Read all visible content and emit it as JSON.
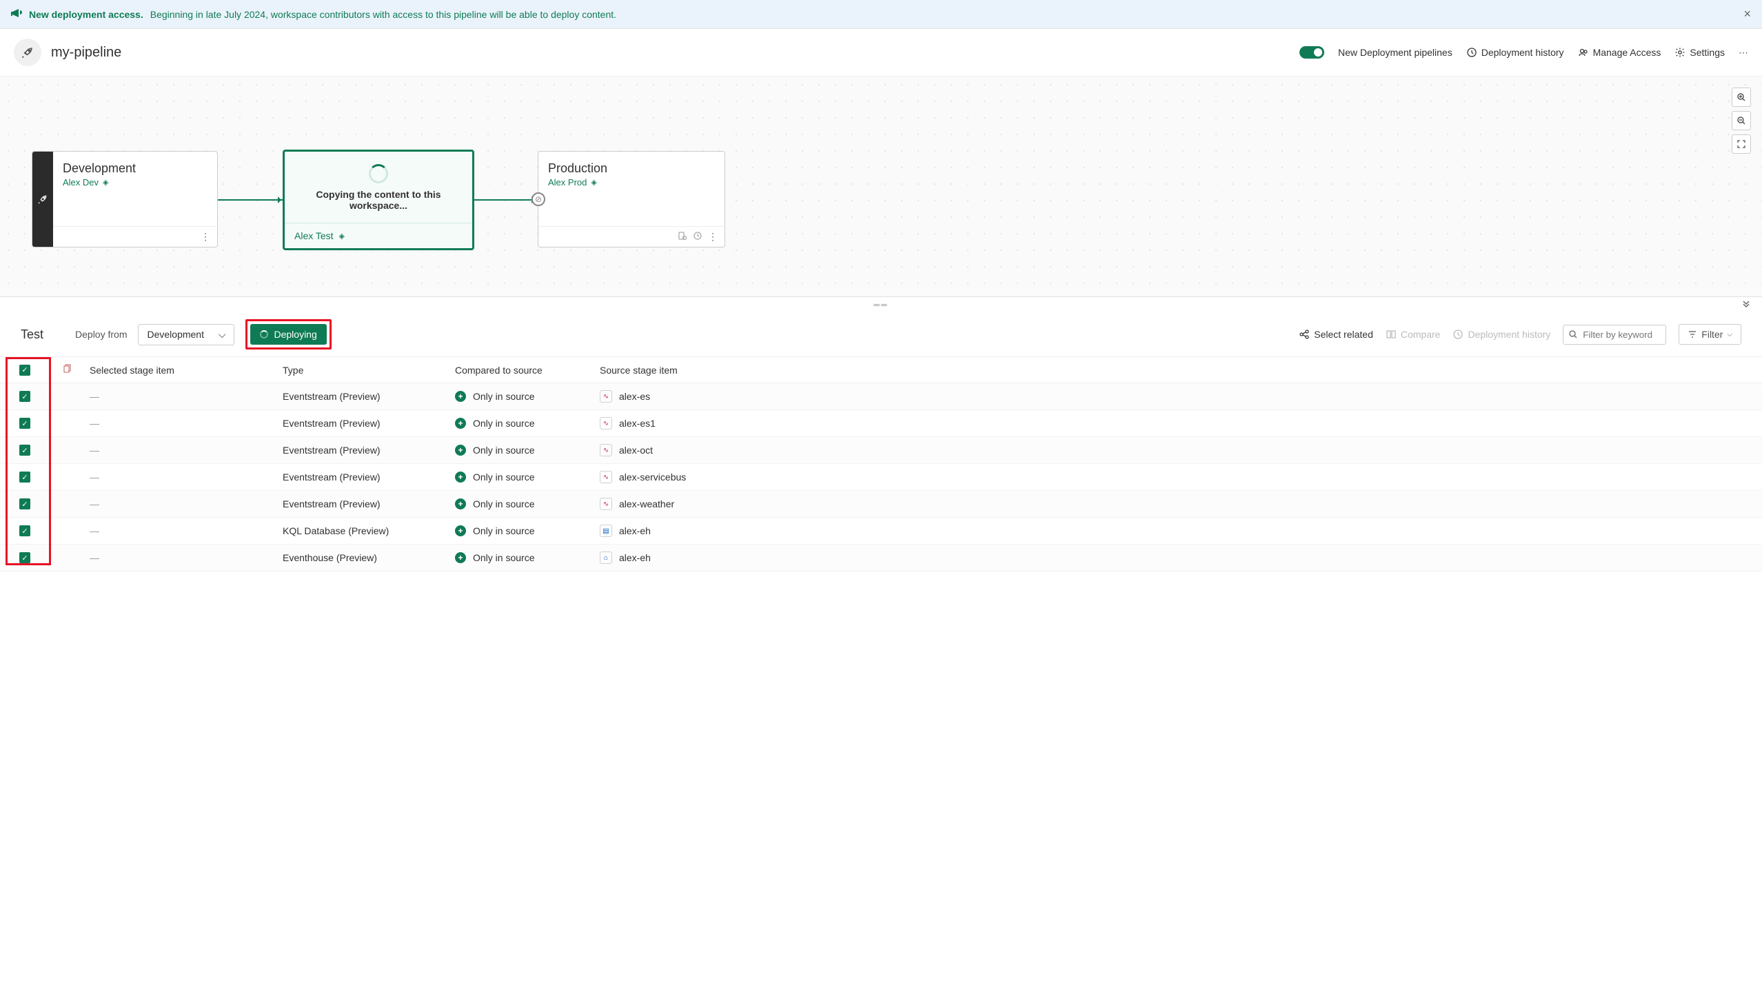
{
  "banner": {
    "title": "New deployment access.",
    "text": "Beginning in late July 2024, workspace contributors with access to this pipeline will be able to deploy content."
  },
  "header": {
    "title": "my-pipeline",
    "toggle_label": "New Deployment pipelines",
    "history": "Deployment history",
    "access": "Manage Access",
    "settings": "Settings"
  },
  "stages": {
    "dev": {
      "title": "Development",
      "sub": "Alex Dev"
    },
    "test": {
      "copying": "Copying the content to this workspace...",
      "sub": "Alex Test"
    },
    "prod": {
      "title": "Production",
      "sub": "Alex Prod"
    }
  },
  "toolbar": {
    "title": "Test",
    "deploy_from_label": "Deploy from",
    "deploy_from_value": "Development",
    "deploying": "Deploying",
    "select_related": "Select related",
    "compare": "Compare",
    "history": "Deployment history",
    "search_placeholder": "Filter by keyword",
    "filter": "Filter"
  },
  "table": {
    "headers": {
      "selected": "Selected stage item",
      "type": "Type",
      "compared": "Compared to source",
      "source": "Source stage item"
    },
    "rows": [
      {
        "sel": "—",
        "type": "Eventstream (Preview)",
        "comp": "Only in source",
        "src": "alex-es",
        "icon": "es"
      },
      {
        "sel": "—",
        "type": "Eventstream (Preview)",
        "comp": "Only in source",
        "src": "alex-es1",
        "icon": "es"
      },
      {
        "sel": "—",
        "type": "Eventstream (Preview)",
        "comp": "Only in source",
        "src": "alex-oct",
        "icon": "es"
      },
      {
        "sel": "—",
        "type": "Eventstream (Preview)",
        "comp": "Only in source",
        "src": "alex-servicebus",
        "icon": "es"
      },
      {
        "sel": "—",
        "type": "Eventstream (Preview)",
        "comp": "Only in source",
        "src": "alex-weather",
        "icon": "es"
      },
      {
        "sel": "—",
        "type": "KQL Database (Preview)",
        "comp": "Only in source",
        "src": "alex-eh",
        "icon": "db"
      },
      {
        "sel": "—",
        "type": "Eventhouse (Preview)",
        "comp": "Only in source",
        "src": "alex-eh",
        "icon": "eh"
      }
    ]
  }
}
